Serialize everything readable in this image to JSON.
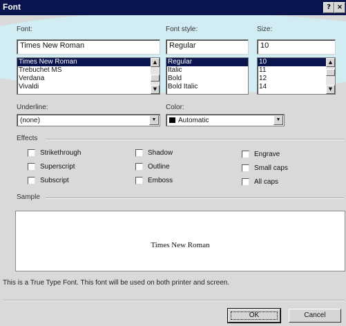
{
  "window": {
    "title": "Font",
    "help_btn": "?",
    "close_btn": "×"
  },
  "font": {
    "label": "Font:",
    "value": "Times New Roman",
    "items": [
      "Times New Roman",
      "Trebuchet MS",
      "Verdana",
      "Vivaldi"
    ],
    "selected_index": 0
  },
  "style": {
    "label": "Font style:",
    "value": "Regular",
    "items": [
      "Regular",
      "Italic",
      "Bold",
      "Bold Italic"
    ],
    "selected_index": 0
  },
  "size": {
    "label": "Size:",
    "value": "10",
    "items": [
      "10",
      "11",
      "12",
      "14"
    ],
    "selected_index": 0
  },
  "underline": {
    "label": "Underline:",
    "value": "(none)"
  },
  "color": {
    "label": "Color:",
    "value": "Automatic",
    "swatch": "#000000"
  },
  "effects": {
    "label": "Effects",
    "col1": [
      "Strikethrough",
      "Superscript",
      "Subscript"
    ],
    "col2": [
      "Shadow",
      "Outline",
      "Emboss"
    ],
    "col3": [
      "Engrave",
      "Small caps",
      "All caps"
    ]
  },
  "sample": {
    "label": "Sample",
    "text": "Times New Roman"
  },
  "info": "This is a True Type Font.  This font will be used on both printer and screen.",
  "buttons": {
    "ok": "OK",
    "cancel": "Cancel"
  },
  "colors": {
    "titlebar": "#0a1550",
    "highlight": "#0a1550",
    "swoosh": "#cfeef6"
  }
}
